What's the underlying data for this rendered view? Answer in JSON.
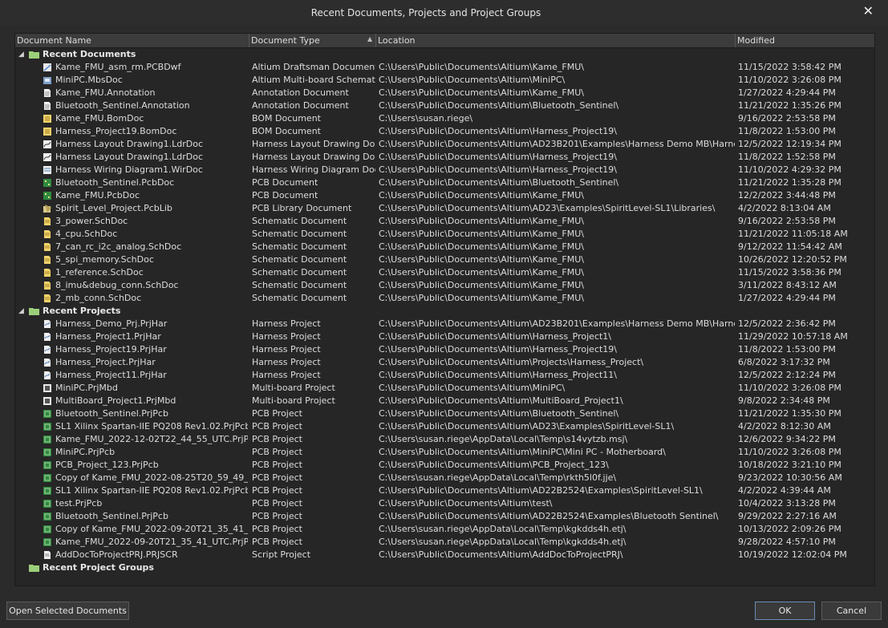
{
  "dialog": {
    "title": "Recent Documents, Projects and Project Groups",
    "close_glyph": "✕"
  },
  "columns": {
    "name": "Document Name",
    "type": "Document Type",
    "location": "Location",
    "modified": "Modified"
  },
  "groups": {
    "documents": "Recent Documents",
    "projects": "Recent Projects",
    "project_groups": "Recent Project Groups"
  },
  "documents": [
    {
      "name": "Kame_FMU_asm_rm.PCBDwf",
      "type": "Altium Draftsman Document",
      "location": "C:\\Users\\Public\\Documents\\Altium\\Kame_FMU\\",
      "modified": "11/15/2022 3:58:42 PM",
      "icon": "draftsman-icon"
    },
    {
      "name": "MiniPC.MbsDoc",
      "type": "Altium Multi-board Schematic",
      "location": "C:\\Users\\Public\\Documents\\Altium\\MiniPC\\",
      "modified": "11/10/2022 3:26:08 PM",
      "icon": "multiboard-schematic-icon"
    },
    {
      "name": "Kame_FMU.Annotation",
      "type": "Annotation Document",
      "location": "C:\\Users\\Public\\Documents\\Altium\\Kame_FMU\\",
      "modified": "1/27/2022 4:29:44 PM",
      "icon": "annotation-icon"
    },
    {
      "name": "Bluetooth_Sentinel.Annotation",
      "type": "Annotation Document",
      "location": "C:\\Users\\Public\\Documents\\Altium\\Bluetooth_Sentinel\\",
      "modified": "11/21/2022 1:35:26 PM",
      "icon": "annotation-icon"
    },
    {
      "name": "Kame_FMU.BomDoc",
      "type": "BOM Document",
      "location": "C:\\Users\\susan.riege\\",
      "modified": "9/16/2022 2:53:58 PM",
      "icon": "bom-icon"
    },
    {
      "name": "Harness_Project19.BomDoc",
      "type": "BOM Document",
      "location": "C:\\Users\\Public\\Documents\\Altium\\Harness_Project19\\",
      "modified": "11/8/2022 1:53:00 PM",
      "icon": "bom-icon"
    },
    {
      "name": "Harness Layout Drawing1.LdrDoc",
      "type": "Harness Layout Drawing Docu",
      "location": "C:\\Users\\Public\\Documents\\Altium\\AD23B201\\Examples\\Harness Demo MB\\Harness_De",
      "modified": "12/5/2022 12:19:34 PM",
      "icon": "harness-layout-icon"
    },
    {
      "name": "Harness Layout Drawing1.LdrDoc",
      "type": "Harness Layout Drawing Docu",
      "location": "C:\\Users\\Public\\Documents\\Altium\\Harness_Project19\\",
      "modified": "11/8/2022 1:52:58 PM",
      "icon": "harness-layout-icon"
    },
    {
      "name": "Harness Wiring Diagram1.WirDoc",
      "type": "Harness Wiring Diagram Docu",
      "location": "C:\\Users\\Public\\Documents\\Altium\\Harness_Project19\\",
      "modified": "11/10/2022 4:29:32 PM",
      "icon": "wiring-diagram-icon"
    },
    {
      "name": "Bluetooth_Sentinel.PcbDoc",
      "type": "PCB Document",
      "location": "C:\\Users\\Public\\Documents\\Altium\\Bluetooth_Sentinel\\",
      "modified": "11/21/2022 1:35:28 PM",
      "icon": "pcb-doc-icon"
    },
    {
      "name": "Kame_FMU.PcbDoc",
      "type": "PCB Document",
      "location": "C:\\Users\\Public\\Documents\\Altium\\Kame_FMU\\",
      "modified": "12/2/2022 3:44:48 PM",
      "icon": "pcb-doc-icon"
    },
    {
      "name": "Spirit_Level_Project.PcbLib",
      "type": "PCB Library Document",
      "location": "C:\\Users\\Public\\Documents\\Altium\\AD23\\Examples\\SpiritLevel-SL1\\Libraries\\",
      "modified": "4/2/2022 8:13:04 AM",
      "icon": "pcb-library-icon"
    },
    {
      "name": "3_power.SchDoc",
      "type": "Schematic Document",
      "location": "C:\\Users\\Public\\Documents\\Altium\\Kame_FMU\\",
      "modified": "9/16/2022 2:53:58 PM",
      "icon": "schematic-icon"
    },
    {
      "name": "4_cpu.SchDoc",
      "type": "Schematic Document",
      "location": "C:\\Users\\Public\\Documents\\Altium\\Kame_FMU\\",
      "modified": "11/21/2022 11:05:18 AM",
      "icon": "schematic-icon"
    },
    {
      "name": "7_can_rc_i2c_analog.SchDoc",
      "type": "Schematic Document",
      "location": "C:\\Users\\Public\\Documents\\Altium\\Kame_FMU\\",
      "modified": "9/12/2022 11:54:42 AM",
      "icon": "schematic-icon"
    },
    {
      "name": "5_spi_memory.SchDoc",
      "type": "Schematic Document",
      "location": "C:\\Users\\Public\\Documents\\Altium\\Kame_FMU\\",
      "modified": "10/26/2022 12:20:52 PM",
      "icon": "schematic-icon"
    },
    {
      "name": "1_reference.SchDoc",
      "type": "Schematic Document",
      "location": "C:\\Users\\Public\\Documents\\Altium\\Kame_FMU\\",
      "modified": "11/15/2022 3:58:36 PM",
      "icon": "schematic-icon"
    },
    {
      "name": "8_imu&debug_conn.SchDoc",
      "type": "Schematic Document",
      "location": "C:\\Users\\Public\\Documents\\Altium\\Kame_FMU\\",
      "modified": "3/11/2022 8:43:12 AM",
      "icon": "schematic-icon"
    },
    {
      "name": "2_mb_conn.SchDoc",
      "type": "Schematic Document",
      "location": "C:\\Users\\Public\\Documents\\Altium\\Kame_FMU\\",
      "modified": "1/27/2022 4:29:44 PM",
      "icon": "schematic-icon"
    }
  ],
  "projects": [
    {
      "name": "Harness_Demo_Prj.PrjHar",
      "type": "Harness Project",
      "location": "C:\\Users\\Public\\Documents\\Altium\\AD23B201\\Examples\\Harness Demo MB\\Harness_De",
      "modified": "12/5/2022 2:36:42 PM",
      "icon": "harness-project-icon"
    },
    {
      "name": "Harness_Project1.PrjHar",
      "type": "Harness Project",
      "location": "C:\\Users\\Public\\Documents\\Altium\\Harness_Project1\\",
      "modified": "11/29/2022 10:57:18 AM",
      "icon": "harness-project-icon"
    },
    {
      "name": "Harness_Project19.PrjHar",
      "type": "Harness Project",
      "location": "C:\\Users\\Public\\Documents\\Altium\\Harness_Project19\\",
      "modified": "11/8/2022 1:53:00 PM",
      "icon": "harness-project-icon"
    },
    {
      "name": "Harness_Project.PrjHar",
      "type": "Harness Project",
      "location": "C:\\Users\\Public\\Documents\\Altium\\Projects\\Harness_Project\\",
      "modified": "6/8/2022 3:17:32 PM",
      "icon": "harness-project-icon"
    },
    {
      "name": "Harness_Project11.PrjHar",
      "type": "Harness Project",
      "location": "C:\\Users\\Public\\Documents\\Altium\\Harness_Project11\\",
      "modified": "12/5/2022 2:12:24 PM",
      "icon": "harness-project-icon"
    },
    {
      "name": "MiniPC.PrjMbd",
      "type": "Multi-board Project",
      "location": "C:\\Users\\Public\\Documents\\Altium\\MiniPC\\",
      "modified": "11/10/2022 3:26:08 PM",
      "icon": "multiboard-project-icon"
    },
    {
      "name": "MultiBoard_Project1.PrjMbd",
      "type": "Multi-board Project",
      "location": "C:\\Users\\Public\\Documents\\Altium\\MultiBoard_Project1\\",
      "modified": "9/8/2022 2:34:48 PM",
      "icon": "multiboard-project-icon"
    },
    {
      "name": "Bluetooth_Sentinel.PrjPcb",
      "type": "PCB Project",
      "location": "C:\\Users\\Public\\Documents\\Altium\\Bluetooth_Sentinel\\",
      "modified": "11/21/2022 1:35:30 PM",
      "icon": "pcb-project-icon"
    },
    {
      "name": "SL1 Xilinx Spartan-IIE PQ208 Rev1.02.PrjPcb",
      "type": "PCB Project",
      "location": "C:\\Users\\Public\\Documents\\Altium\\AD23\\Examples\\SpiritLevel-SL1\\",
      "modified": "4/2/2022 8:12:30 AM",
      "icon": "pcb-project-icon"
    },
    {
      "name": "Kame_FMU_2022-12-02T22_44_55_UTC.PrjPcb",
      "type": "PCB Project",
      "location": "C:\\Users\\susan.riege\\AppData\\Local\\Temp\\s14vytzb.msj\\",
      "modified": "12/6/2022 9:34:22 PM",
      "icon": "pcb-project-icon"
    },
    {
      "name": "MiniPC.PrjPcb",
      "type": "PCB Project",
      "location": "C:\\Users\\Public\\Documents\\Altium\\MiniPC\\Mini PC - Motherboard\\",
      "modified": "11/10/2022 3:26:08 PM",
      "icon": "pcb-project-icon"
    },
    {
      "name": "PCB_Project_123.PrjPcb",
      "type": "PCB Project",
      "location": "C:\\Users\\Public\\Documents\\Altium\\PCB_Project_123\\",
      "modified": "10/18/2022 3:21:10 PM",
      "icon": "pcb-project-icon"
    },
    {
      "name": "Copy of Kame_FMU_2022-08-25T20_59_49_UTC.",
      "type": "PCB Project",
      "location": "C:\\Users\\susan.riege\\AppData\\Local\\Temp\\rkth5l0f.jje\\",
      "modified": "9/23/2022 10:30:56 AM",
      "icon": "pcb-project-icon"
    },
    {
      "name": "SL1 Xilinx Spartan-IIE PQ208 Rev1.02.PrjPcb",
      "type": "PCB Project",
      "location": "C:\\Users\\Public\\Documents\\Altium\\AD22B2524\\Examples\\SpiritLevel-SL1\\",
      "modified": "4/2/2022 4:39:44 AM",
      "icon": "pcb-project-icon"
    },
    {
      "name": "test.PrjPcb",
      "type": "PCB Project",
      "location": "C:\\Users\\Public\\Documents\\Altium\\test\\",
      "modified": "10/4/2022 3:13:28 PM",
      "icon": "pcb-project-icon"
    },
    {
      "name": "Bluetooth_Sentinel.PrjPcb",
      "type": "PCB Project",
      "location": "C:\\Users\\Public\\Documents\\Altium\\AD22B2524\\Examples\\Bluetooth Sentinel\\",
      "modified": "9/29/2022 2:27:16 AM",
      "icon": "pcb-project-icon"
    },
    {
      "name": "Copy of Kame_FMU_2022-09-20T21_35_41_UTC.",
      "type": "PCB Project",
      "location": "C:\\Users\\susan.riege\\AppData\\Local\\Temp\\kgkdds4h.etj\\",
      "modified": "10/13/2022 2:09:26 PM",
      "icon": "pcb-project-icon"
    },
    {
      "name": "Kame_FMU_2022-09-20T21_35_41_UTC.PrjPcb",
      "type": "PCB Project",
      "location": "C:\\Users\\susan.riege\\AppData\\Local\\Temp\\kgkdds4h.etj\\",
      "modified": "9/28/2022 4:57:10 PM",
      "icon": "pcb-project-icon"
    },
    {
      "name": "AddDocToProjectPRJ.PRJSCR",
      "type": "Script Project",
      "location": "C:\\Users\\Public\\Documents\\Altium\\AddDocToProjectPRJ\\",
      "modified": "10/19/2022 12:02:04 PM",
      "icon": "script-project-icon"
    }
  ],
  "buttons": {
    "open": "Open Selected Documents",
    "ok": "OK",
    "cancel": "Cancel"
  },
  "colors": {
    "background": "#2b2b2b",
    "grid_background": "#262626",
    "header": "#3c3c3c",
    "folder": "#9ccf7a",
    "ok_border": "#6a8cb3"
  }
}
